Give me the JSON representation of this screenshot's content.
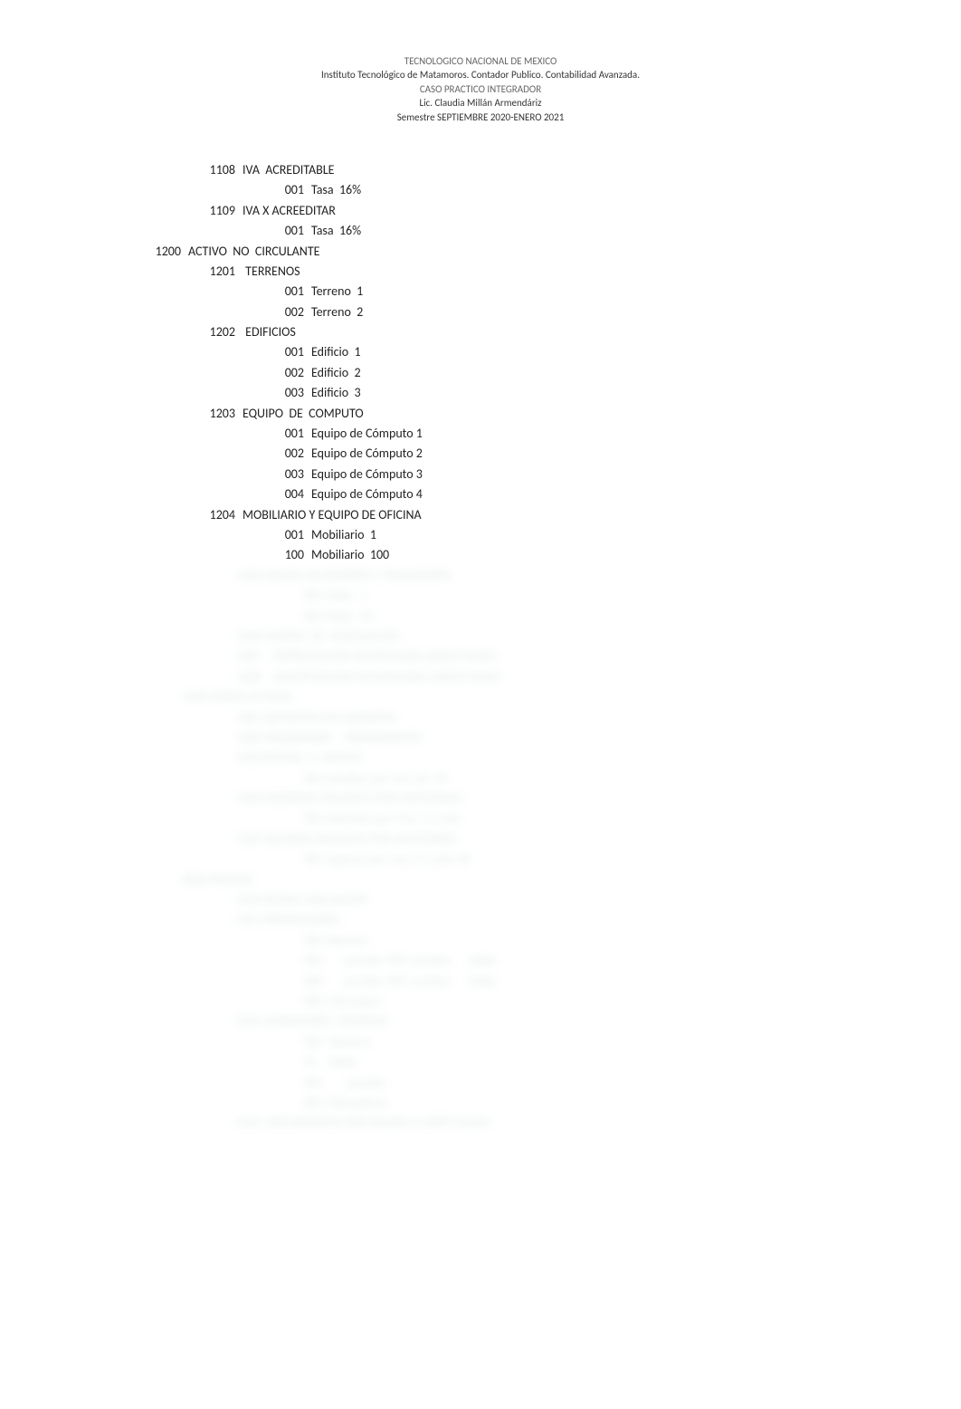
{
  "header": {
    "line1": "TECNOLOGICO NACIONAL DE MEXICO",
    "line2": "Instituto Tecnológico de Matamoros. Contador Publico. Contabilidad Avanzada.",
    "line3": "CASO PRACTICO INTEGRADOR",
    "line4": "Lic. Claudia Millán Armendáriz",
    "line5": "Semestre SEPTIEMBRE 2020-ENERO 2021"
  },
  "rows": [
    {
      "level": 2,
      "code": "1108",
      "text": "IVA  ACREDITABLE"
    },
    {
      "level": 3,
      "code": "001",
      "text": "Tasa  16%"
    },
    {
      "level": 2,
      "code": "1109",
      "text": "IVA X ACREEDITAR"
    },
    {
      "level": 3,
      "code": "001",
      "text": "Tasa  16%"
    },
    {
      "level": 1,
      "code": "1200",
      "text": "ACTIVO  NO  CIRCULANTE"
    },
    {
      "level": 2,
      "code": "1201",
      "text": " TERRENOS"
    },
    {
      "level": 3,
      "code": "001",
      "text": "Terreno  1"
    },
    {
      "level": 3,
      "code": "002",
      "text": "Terreno  2"
    },
    {
      "level": 2,
      "code": "1202",
      "text": " EDIFICIOS"
    },
    {
      "level": 3,
      "code": "001",
      "text": "Edificio  1"
    },
    {
      "level": 3,
      "code": "002",
      "text": "Edificio  2"
    },
    {
      "level": 3,
      "code": "003",
      "text": "Edificio  3"
    },
    {
      "level": 2,
      "code": "1203",
      "text": "EQUIPO  DE  COMPUTO"
    },
    {
      "level": 3,
      "code": "001",
      "text": "Equipo de Cómputo 1"
    },
    {
      "level": 3,
      "code": "002",
      "text": "Equipo de Cómputo 2"
    },
    {
      "level": 3,
      "code": "003",
      "text": "Equipo de Cómputo 3"
    },
    {
      "level": 3,
      "code": "004",
      "text": "Equipo de Cómputo 4"
    },
    {
      "level": 2,
      "code": "1204",
      "text": "MOBILIARIO Y EQUIPO DE OFICINA"
    },
    {
      "level": 3,
      "code": "001",
      "text": "Mobiliario  1"
    },
    {
      "level": 3,
      "code": "100",
      "text": "Mobiliario  100"
    }
  ],
  "blurred_rows": [
    {
      "level": 2,
      "text": "1205 EQUIPO DE REPARTO Y TRANSPORTE"
    },
    {
      "level": 3,
      "text": "001 Vehic  1"
    },
    {
      "level": 3,
      "text": "002 Vehic  10"
    },
    {
      "level": 2,
      "text": "1206 GASTOS  DE  INSTALACION"
    },
    {
      "level": 2,
      "text": "1207    DEPRECIACION ACUMULADA LARGO PLAZO"
    },
    {
      "level": 2,
      "text": "1208    AMORTIZACION ACUMULADA LARGO PLAZO"
    },
    {
      "level": 1,
      "text": "1300 OTROS ACTIVOS"
    },
    {
      "level": 2,
      "text": "1301 DEPOSITOS EN GARANTIA"
    },
    {
      "level": 2,
      "text": "1302 INVERSIONES    PERMANENTES"
    },
    {
      "level": 2,
      "text": "1303 RENTAS  X  ANTICIP"
    },
    {
      "level": 3,
      "text": "001 pendien por resc de  20"
    },
    {
      "level": 2,
      "text": "1304 INTERESES PAGADOS POR ANTICIPADO"
    },
    {
      "level": 3,
      "text": "001 intereses por resc 1.5 anio "
    },
    {
      "level": 2,
      "text": "1305 SEGUROS PAGADOS POR ANTICIPADO"
    },
    {
      "level": 3,
      "text": "001 seguros por resc 2.5 anio 20"
    },
    {
      "level": 0,
      "text": ""
    },
    {
      "level": 0,
      "text": ""
    },
    {
      "level": 1,
      "text": "2000 PASIVOS"
    },
    {
      "level": 2,
      "text": "2100 PASIVO CIRCULANTE"
    },
    {
      "level": 2,
      "text": "2101 PROVEEDORES"
    },
    {
      "level": 3,
      "text": "001 Naciona"
    },
    {
      "level": 3,
      "text": "001       provide  RFC nombre      Saldo "
    },
    {
      "level": 3,
      "text": "002       provide  RFC nombre      Saldo "
    },
    {
      "level": 3,
      "text": "002  Extranjero"
    },
    {
      "level": 2,
      "text": "2102 ACREEDORES  DIVERSOS"
    },
    {
      "level": 3,
      "text": "001  Naciona"
    },
    {
      "level": 3,
      "text": "01    Saldo "
    },
    {
      "level": 3,
      "text": "001        provide"
    },
    {
      "level": 3,
      "text": "002  Extranjeros"
    },
    {
      "level": 2,
      "text": "2103  DOCUMENTOS POR PAGAR A CORTO PLAZO"
    }
  ]
}
